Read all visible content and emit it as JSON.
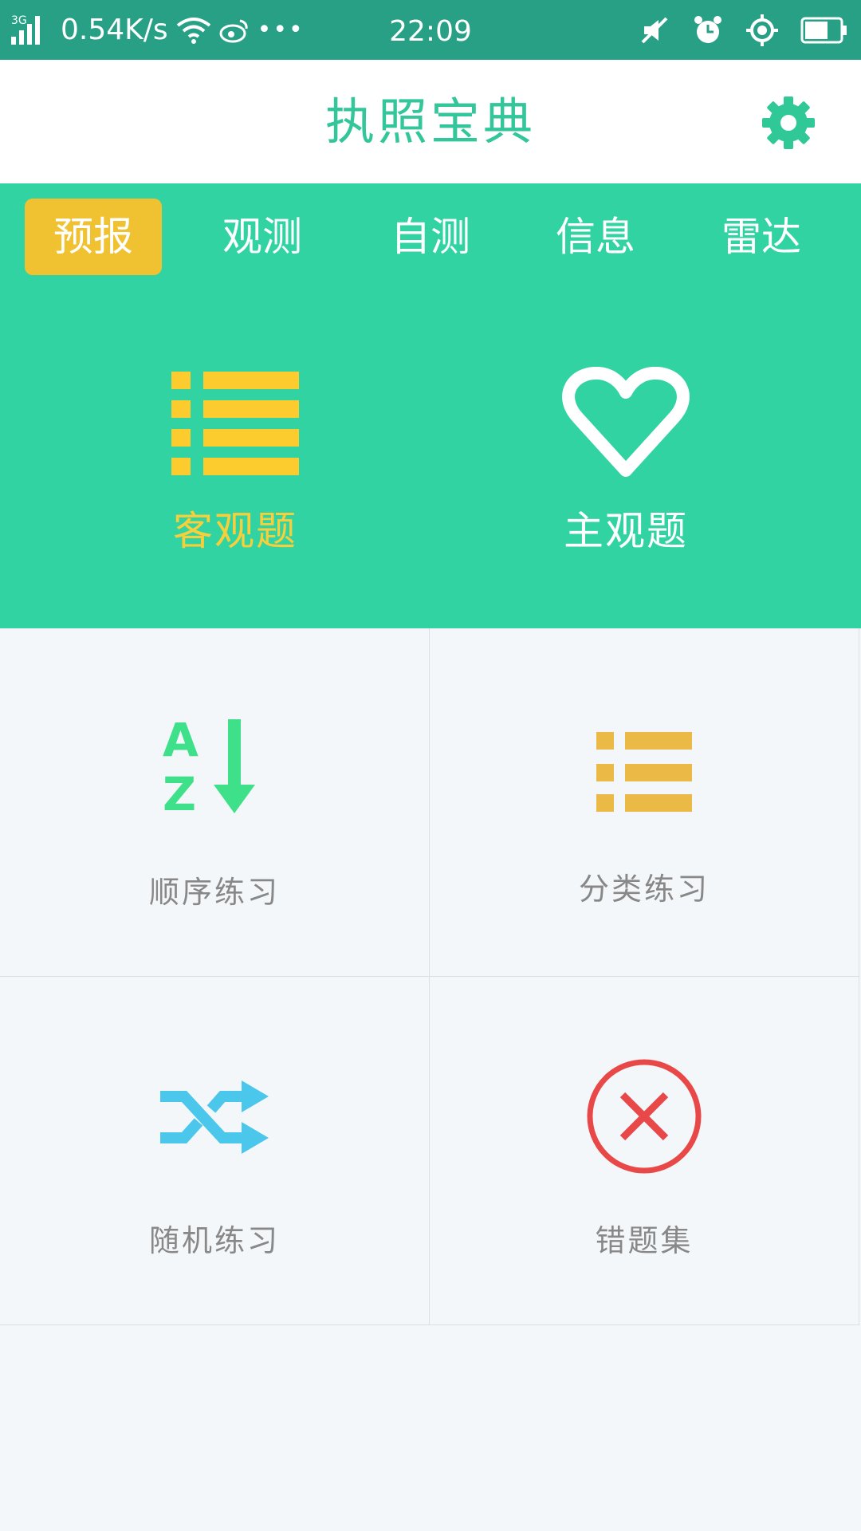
{
  "status_bar": {
    "network": "3G",
    "speed": "0.54K/s",
    "time": "22:09"
  },
  "header": {
    "title": "执照宝典"
  },
  "tabs": [
    {
      "label": "预报",
      "active": true
    },
    {
      "label": "观测",
      "active": false
    },
    {
      "label": "自测",
      "active": false
    },
    {
      "label": "信息",
      "active": false
    },
    {
      "label": "雷达",
      "active": false
    }
  ],
  "hero": {
    "objective": {
      "label": "客观题",
      "icon": "list-icon"
    },
    "subjective": {
      "label": "主观题",
      "icon": "heart-icon"
    }
  },
  "grid": [
    {
      "label": "顺序练习",
      "icon": "sort-az-icon"
    },
    {
      "label": "分类练习",
      "icon": "list-icon"
    },
    {
      "label": "随机练习",
      "icon": "shuffle-icon"
    },
    {
      "label": "错题集",
      "icon": "wrong-x-icon"
    }
  ],
  "colors": {
    "status_bar": "#27a085",
    "brand_green": "#32d3a2",
    "active_tab": "#f0c232",
    "yellow": "#f6cf3a",
    "green_icon": "#3ee08a",
    "orange_icon": "#ebb945",
    "blue_icon": "#4cc7ec",
    "red_icon": "#e84848"
  }
}
